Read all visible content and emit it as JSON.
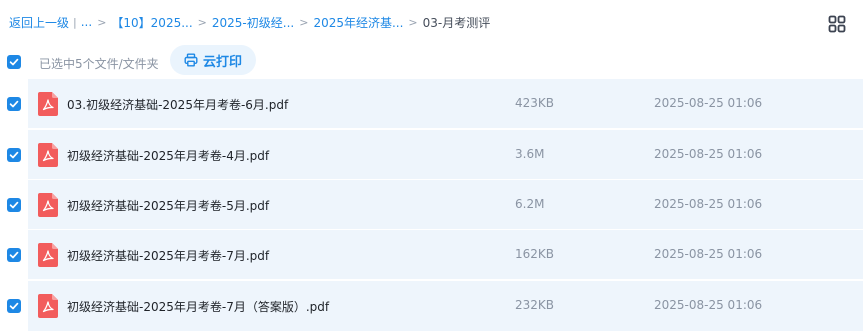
{
  "breadcrumb": {
    "back": "返回上一级",
    "divider": "|",
    "ellipsis": "...",
    "sep": ">",
    "crumbs": [
      "【10】2025...",
      "2025-初级经...",
      "2025年经济基..."
    ],
    "current": "03-月考测评"
  },
  "toolbar": {
    "selected_text": "已选中5个文件/文件夹",
    "print_label": "云打印"
  },
  "files": [
    {
      "name": "03.初级经济基础-2025年月考卷-6月.pdf",
      "size": "423KB",
      "date": "2025-08-25 01:06"
    },
    {
      "name": "初级经济基础-2025年月考卷-4月.pdf",
      "size": "3.6M",
      "date": "2025-08-25 01:06"
    },
    {
      "name": "初级经济基础-2025年月考卷-5月.pdf",
      "size": "6.2M",
      "date": "2025-08-25 01:06"
    },
    {
      "name": "初级经济基础-2025年月考卷-7月.pdf",
      "size": "162KB",
      "date": "2025-08-25 01:06"
    },
    {
      "name": "初级经济基础-2025年月考卷-7月（答案版）.pdf",
      "size": "232KB",
      "date": "2025-08-25 01:06"
    }
  ],
  "colors": {
    "accent": "#1e88e5",
    "row_selected_bg": "#eef5fc",
    "pdf_red": "#f25c5c"
  },
  "icons": {
    "view_toggle": "grid-view-icon",
    "print": "printer-icon",
    "file": "pdf-file-icon",
    "checkbox": "checkmark-icon"
  }
}
